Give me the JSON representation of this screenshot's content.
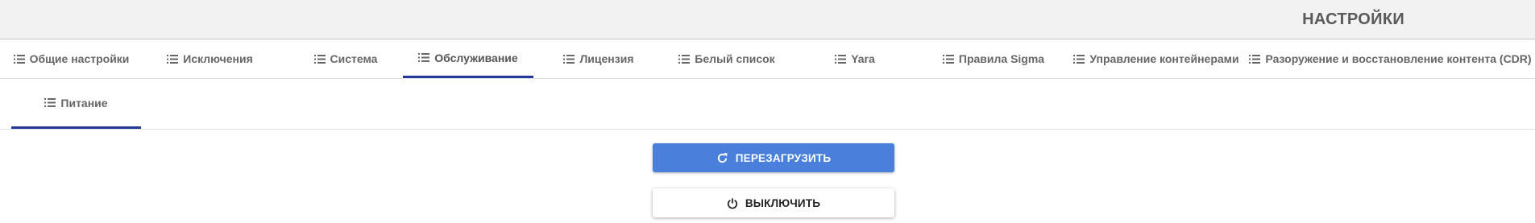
{
  "header": {
    "title": "НАСТРОЙКИ"
  },
  "tabs": [
    {
      "label": "Общие настройки",
      "icon": "list-icon",
      "active": false
    },
    {
      "label": "Исключения",
      "icon": "list-icon",
      "active": false
    },
    {
      "label": "Система",
      "icon": "list-icon",
      "active": false
    },
    {
      "label": "Обслуживание",
      "icon": "list-icon",
      "active": true
    },
    {
      "label": "Лицензия",
      "icon": "list-icon",
      "active": false
    },
    {
      "label": "Белый список",
      "icon": "list-icon",
      "active": false
    },
    {
      "label": "Yara",
      "icon": "list-icon",
      "active": false
    },
    {
      "label": "Правила Sigma",
      "icon": "list-icon",
      "active": false
    },
    {
      "label": "Управление контейнерами",
      "icon": "list-icon",
      "active": false
    },
    {
      "label": "Разоружение и восстановление контента (CDR)",
      "icon": "list-icon",
      "active": false
    }
  ],
  "subtabs": [
    {
      "label": "Питание",
      "icon": "list-icon",
      "active": true
    }
  ],
  "actions": {
    "restart_label": "ПЕРЕЗАГРУЗИТЬ",
    "restart_icon": "refresh-icon",
    "shutdown_label": "ВЫКЛЮЧИТЬ",
    "shutdown_icon": "power-icon"
  },
  "colors": {
    "accent_underline": "#24389b",
    "primary_button": "#4a80dc"
  }
}
